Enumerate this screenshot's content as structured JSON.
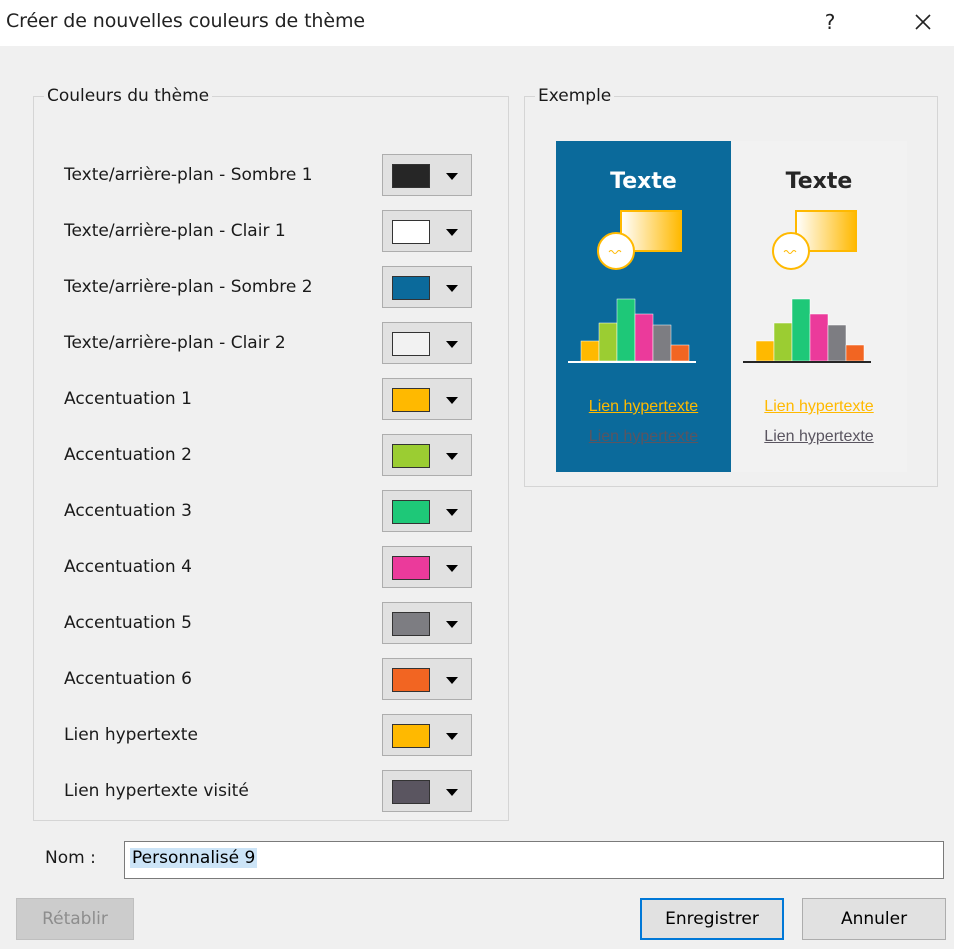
{
  "window": {
    "title": "Créer de nouvelles couleurs de thème",
    "help_glyph": "?"
  },
  "theme_colors": {
    "legend": "Couleurs du thème",
    "items": [
      {
        "label": "Texte/arrière-plan - Sombre 1",
        "color": "#262626"
      },
      {
        "label": "Texte/arrière-plan - Clair 1",
        "color": "#ffffff"
      },
      {
        "label": "Texte/arrière-plan - Sombre 2",
        "color": "#0b6a9b"
      },
      {
        "label": "Texte/arrière-plan - Clair 2",
        "color": "#f2f2f2"
      },
      {
        "label": "Accentuation 1",
        "color": "#ffb900"
      },
      {
        "label": "Accentuation 2",
        "color": "#9bcd32"
      },
      {
        "label": "Accentuation 3",
        "color": "#1ec878"
      },
      {
        "label": "Accentuation 4",
        "color": "#eb3a9b"
      },
      {
        "label": "Accentuation 5",
        "color": "#7d7d82"
      },
      {
        "label": "Accentuation 6",
        "color": "#f26522"
      },
      {
        "label": "Lien hypertexte",
        "color": "#ffb900"
      },
      {
        "label": "Lien hypertexte visité",
        "color": "#5a5560"
      }
    ]
  },
  "sample": {
    "legend": "Exemple",
    "dark": {
      "title": "Texte",
      "link": "Lien hypertexte",
      "visited_link": "Lien hypertexte"
    },
    "light": {
      "title": "Texte",
      "link": "Lien hypertexte",
      "visited_link": "Lien hypertexte"
    }
  },
  "name_field": {
    "label": "Nom :",
    "value": "Personnalisé 9"
  },
  "buttons": {
    "reset": "Rétablir",
    "save": "Enregistrer",
    "cancel": "Annuler"
  }
}
